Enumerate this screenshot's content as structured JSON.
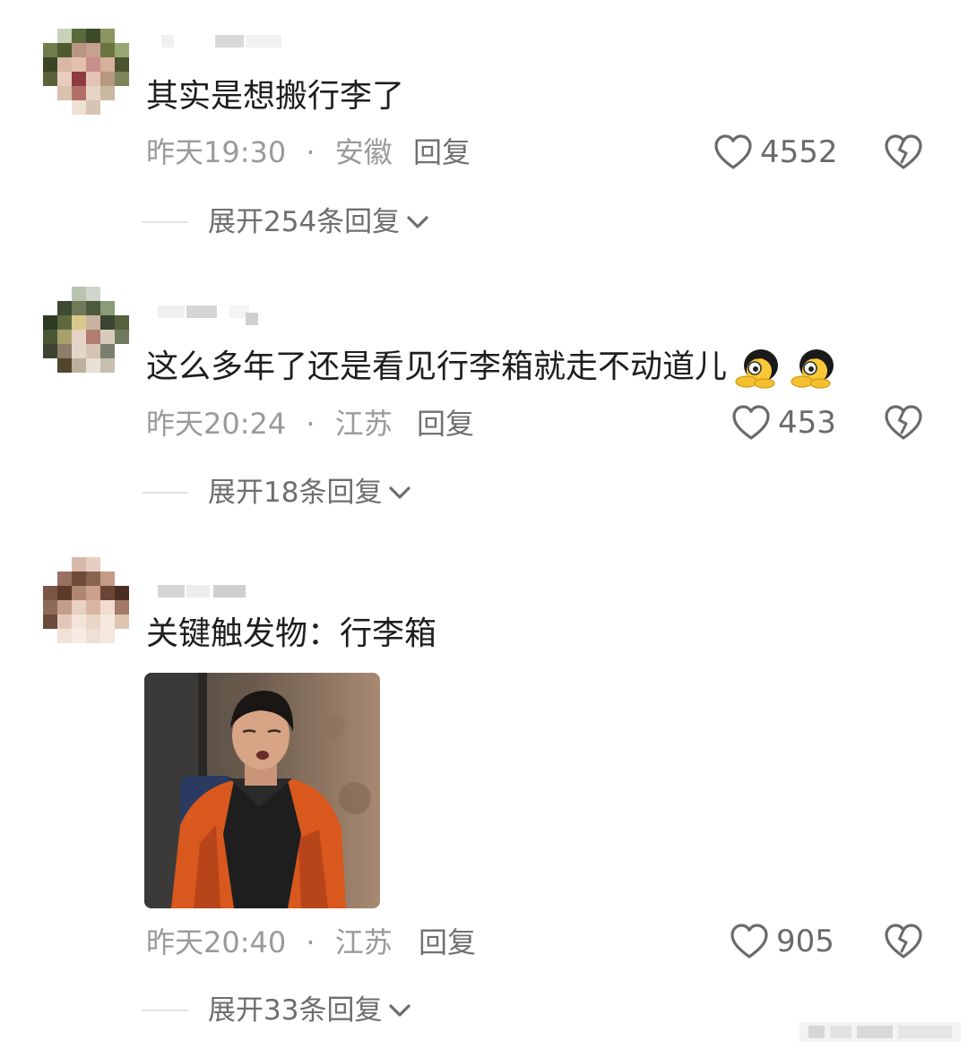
{
  "comments": [
    {
      "text": "其实是想搬行李了",
      "time": "昨天19:30",
      "dot": "·",
      "location": "安徽",
      "reply_label": "回复",
      "likes": "4552",
      "expand_label": "展开254条回复"
    },
    {
      "text": "这么多年了还是看见行李箱就走不动道儿",
      "time": "昨天20:24",
      "dot": "·",
      "location": "江苏",
      "reply_label": "回复",
      "likes": "453",
      "expand_label": "展开18条回复",
      "emojis": [
        "peeking-emoji",
        "peeking-emoji"
      ]
    },
    {
      "text": "关键触发物：行李箱",
      "time": "昨天20:40",
      "dot": "·",
      "location": "江苏",
      "reply_label": "回复",
      "likes": "905",
      "expand_label": "展开33条回复",
      "image": "man-with-backpack-photo"
    }
  ],
  "colors": {
    "text": "#1e1e1e",
    "meta": "#9a9a9a",
    "reply": "#707070",
    "icon": "#6a6a6a",
    "divider": "#e2e2e2"
  }
}
